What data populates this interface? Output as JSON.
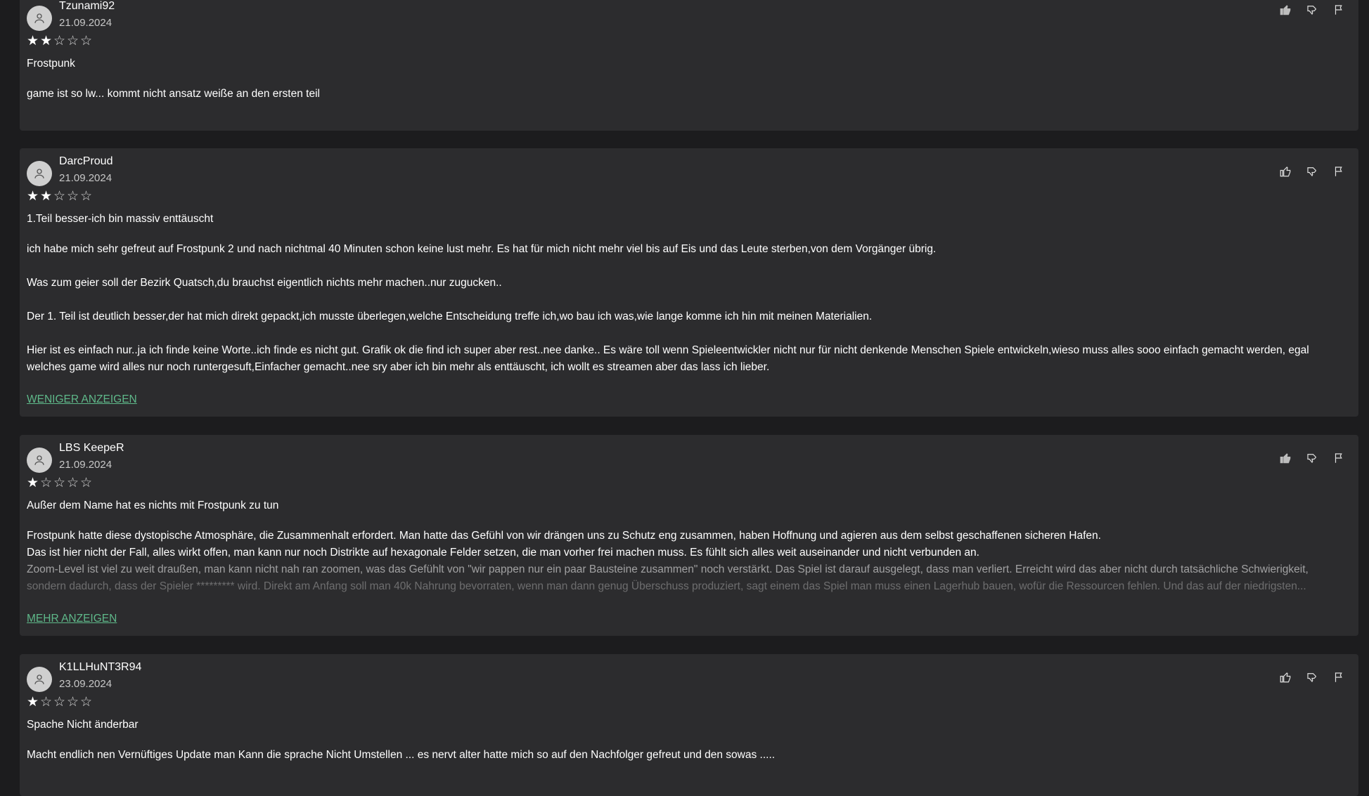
{
  "reviews": [
    {
      "author": "Tzunami92",
      "date": "21.09.2024",
      "rating": 2,
      "title": "Frostpunk",
      "paragraphs": [
        "game ist so lw... kommt nicht ansatz weiße an den ersten teil"
      ],
      "toggle": "",
      "liked": true
    },
    {
      "author": "DarcProud",
      "date": "21.09.2024",
      "rating": 2,
      "title": "1.Teil besser-ich bin massiv enttäuscht",
      "paragraphs": [
        "ich habe mich sehr gefreut auf Frostpunk 2 und nach nichtmal 40 Minuten schon keine lust mehr. Es hat für mich nicht mehr viel bis auf Eis und das Leute sterben,von dem Vorgänger übrig.",
        "Was zum geier soll der Bezirk Quatsch,du brauchst eigentlich nichts mehr machen..nur zugucken..",
        "Der 1. Teil ist deutlich besser,der hat mich direkt gepackt,ich musste überlegen,welche Entscheidung treffe ich,wo bau ich was,wie lange komme ich hin mit meinen Materialien.",
        "Hier ist es einfach nur..ja ich finde keine Worte..ich finde es nicht gut. Grafik ok die find ich super aber rest..nee danke.. Es wäre toll wenn Spieleentwickler nicht nur für nicht denkende Menschen Spiele entwickeln,wieso muss alles sooo einfach gemacht werden, egal welches game wird alles nur noch runtergesuft,Einfacher gemacht..nee sry aber ich bin mehr als enttäuscht, ich wollt es streamen aber das lass ich lieber."
      ],
      "toggle": "WENIGER ANZEIGEN",
      "liked": false
    },
    {
      "author": "LBS KeepeR",
      "date": "21.09.2024",
      "rating": 1,
      "title": "Außer dem Name hat es nichts mit Frostpunk zu tun",
      "lines": [
        "Frostpunk hatte diese dystopische Atmosphäre, die Zusammenhalt erfordert. Man hatte das Gefühl von wir drängen uns zu Schutz eng zusammen, haben Hoffnung und agieren aus dem selbst geschaffenen sicheren Hafen.",
        "Das ist hier nicht der Fall, alles wirkt offen, man kann nur noch Distrikte auf hexagonale Felder setzen, die man vorher frei machen muss. Es fühlt sich alles weit auseinander und nicht verbunden an.",
        "Zoom-Level ist viel zu weit draußen, man kann nicht nah ran zoomen, was das Gefühlt von \"wir pappen nur ein paar Bausteine zusammen\" noch verstärkt. Das Spiel ist darauf ausgelegt, dass man verliert. Erreicht wird das aber nicht durch tatsächliche Schwierigkeit,",
        "sondern dadurch, dass der Spieler ********* wird. Direkt am Anfang soll man 40k Nahrung bevorraten, wenn man dann genug Überschuss produziert, sagt einem das Spiel man muss einen Lagerhub bauen, wofür die Ressourcen fehlen. Und das auf der niedrigsten..."
      ],
      "toggle": "MEHR ANZEIGEN",
      "liked": true
    },
    {
      "author": "K1LLHuNT3R94",
      "date": "23.09.2024",
      "rating": 1,
      "title": "Spache Nicht änderbar",
      "paragraphs": [
        "Macht endlich nen Vernüftiges Update man Kann die sprache Nicht Umstellen ... es nervt alter hatte mich so auf den Nachfolger gefreut und den sowas ....."
      ],
      "toggle": "",
      "liked": false
    }
  ],
  "icons": {
    "avatar": "user-icon",
    "like": "thumbs-up-icon",
    "dislike": "thumbs-down-icon",
    "report": "flag-icon",
    "star_filled": "★",
    "star_empty": "☆"
  },
  "colors": {
    "background": "#1c1c1e",
    "card": "#2c2c2e",
    "link": "#5fb98a"
  }
}
